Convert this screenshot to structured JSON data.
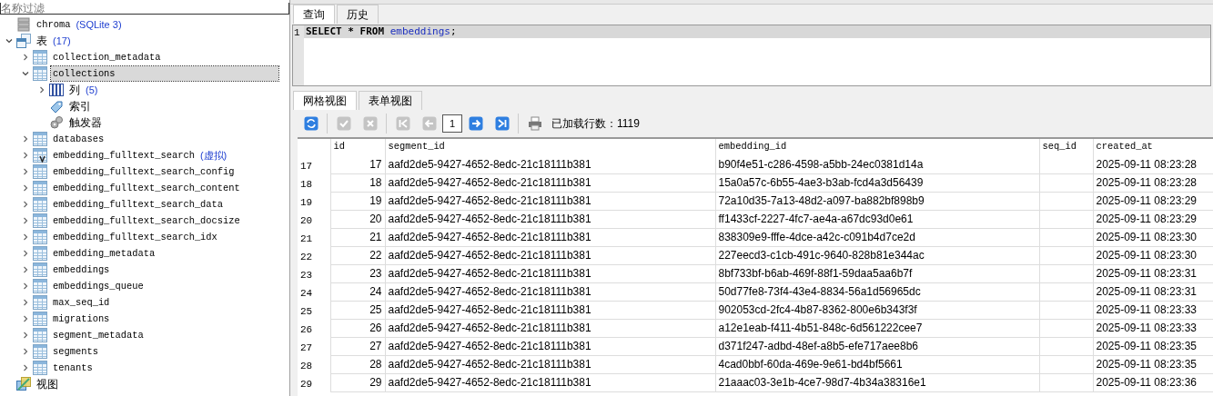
{
  "filter": {
    "placeholder": "名称过滤"
  },
  "tree": [
    {
      "label": "chroma",
      "note": "(SQLite 3)",
      "kind": "database",
      "selected": false,
      "children": [
        {
          "label": "表",
          "note": "(17)",
          "kind": "tables",
          "expanded": true,
          "selected": false,
          "children": [
            {
              "label": "collection_metadata",
              "kind": "table",
              "expanded": false,
              "selected": false
            },
            {
              "label": "collections",
              "kind": "table",
              "expanded": true,
              "selected": true,
              "children": [
                {
                  "label": "列",
                  "note": "(5)",
                  "kind": "columns",
                  "expanded": false,
                  "selected": false
                },
                {
                  "label": "索引",
                  "kind": "index",
                  "selected": false
                },
                {
                  "label": "触发器",
                  "kind": "trigger",
                  "selected": false
                }
              ]
            },
            {
              "label": "databases",
              "kind": "table",
              "expanded": false,
              "selected": false
            },
            {
              "label": "embedding_fulltext_search",
              "note": "(虚拟)",
              "kind": "virtual-table",
              "expanded": false,
              "selected": false
            },
            {
              "label": "embedding_fulltext_search_config",
              "kind": "table",
              "expanded": false,
              "selected": false
            },
            {
              "label": "embedding_fulltext_search_content",
              "kind": "table",
              "expanded": false,
              "selected": false
            },
            {
              "label": "embedding_fulltext_search_data",
              "kind": "table",
              "expanded": false,
              "selected": false
            },
            {
              "label": "embedding_fulltext_search_docsize",
              "kind": "table",
              "expanded": false,
              "selected": false
            },
            {
              "label": "embedding_fulltext_search_idx",
              "kind": "table",
              "expanded": false,
              "selected": false
            },
            {
              "label": "embedding_metadata",
              "kind": "table",
              "expanded": false,
              "selected": false
            },
            {
              "label": "embeddings",
              "kind": "table",
              "expanded": false,
              "selected": false
            },
            {
              "label": "embeddings_queue",
              "kind": "table",
              "expanded": false,
              "selected": false
            },
            {
              "label": "max_seq_id",
              "kind": "table",
              "expanded": false,
              "selected": false
            },
            {
              "label": "migrations",
              "kind": "table",
              "expanded": false,
              "selected": false
            },
            {
              "label": "segment_metadata",
              "kind": "table",
              "expanded": false,
              "selected": false
            },
            {
              "label": "segments",
              "kind": "table",
              "expanded": false,
              "selected": false
            },
            {
              "label": "tenants",
              "kind": "table",
              "expanded": false,
              "selected": false
            }
          ]
        },
        {
          "label": "视图",
          "kind": "views",
          "selected": false
        }
      ]
    }
  ],
  "editor_tabs": [
    {
      "label": "查询",
      "selected": true
    },
    {
      "label": "历史",
      "selected": false
    }
  ],
  "editor": {
    "line_number": "1",
    "tokens": [
      {
        "text": "SELECT * FROM",
        "kind": "keyword"
      },
      {
        "text": "embeddings",
        "kind": "identifier"
      },
      {
        "text": ";",
        "kind": "punct"
      }
    ]
  },
  "result_tabs": [
    {
      "label": "网格视图",
      "selected": true
    },
    {
      "label": "表单视图",
      "selected": false
    }
  ],
  "toolbar": {
    "buttons": [
      {
        "kind": "refresh",
        "disabled": false
      },
      {
        "kind": "apply",
        "disabled": true
      },
      {
        "kind": "cancel",
        "disabled": true
      },
      {
        "kind": "first",
        "disabled": true
      },
      {
        "kind": "prev",
        "disabled": true
      },
      {
        "kind": "page",
        "value": "1"
      },
      {
        "kind": "next",
        "disabled": false
      },
      {
        "kind": "last",
        "disabled": false
      },
      {
        "kind": "print",
        "disabled": false
      }
    ],
    "status": "已加载行数：1119"
  },
  "table": {
    "columns": [
      "id",
      "segment_id",
      "embedding_id",
      "seq_id",
      "created_at"
    ],
    "rows": [
      {
        "row_number": "17",
        "cells": [
          "17",
          "aafd2de5-9427-4652-8edc-21c18111b381",
          "b90f4e51-c286-4598-a5bb-24ec0381d14a",
          "",
          "2025-09-11 08:23:28"
        ]
      },
      {
        "row_number": "18",
        "cells": [
          "18",
          "aafd2de5-9427-4652-8edc-21c18111b381",
          "15a0a57c-6b55-4ae3-b3ab-fcd4a3d56439",
          "",
          "2025-09-11 08:23:28"
        ]
      },
      {
        "row_number": "19",
        "cells": [
          "19",
          "aafd2de5-9427-4652-8edc-21c18111b381",
          "72a10d35-7a13-48d2-a097-ba882bf898b9",
          "",
          "2025-09-11 08:23:29"
        ]
      },
      {
        "row_number": "20",
        "cells": [
          "20",
          "aafd2de5-9427-4652-8edc-21c18111b381",
          "ff1433cf-2227-4fc7-ae4a-a67dc93d0e61",
          "",
          "2025-09-11 08:23:29"
        ]
      },
      {
        "row_number": "21",
        "cells": [
          "21",
          "aafd2de5-9427-4652-8edc-21c18111b381",
          "838309e9-fffe-4dce-a42c-c091b4d7ce2d",
          "",
          "2025-09-11 08:23:30"
        ]
      },
      {
        "row_number": "22",
        "cells": [
          "22",
          "aafd2de5-9427-4652-8edc-21c18111b381",
          "227eecd3-c1cb-491c-9640-828b81e344ac",
          "",
          "2025-09-11 08:23:30"
        ]
      },
      {
        "row_number": "23",
        "cells": [
          "23",
          "aafd2de5-9427-4652-8edc-21c18111b381",
          "8bf733bf-b6ab-469f-88f1-59daa5aa6b7f",
          "",
          "2025-09-11 08:23:31"
        ]
      },
      {
        "row_number": "24",
        "cells": [
          "24",
          "aafd2de5-9427-4652-8edc-21c18111b381",
          "50d77fe8-73f4-43e4-8834-56a1d56965dc",
          "",
          "2025-09-11 08:23:31"
        ]
      },
      {
        "row_number": "25",
        "cells": [
          "25",
          "aafd2de5-9427-4652-8edc-21c18111b381",
          "902053cd-2fc4-4b87-8362-800e6b343f3f",
          "",
          "2025-09-11 08:23:33"
        ]
      },
      {
        "row_number": "26",
        "cells": [
          "26",
          "aafd2de5-9427-4652-8edc-21c18111b381",
          "a12e1eab-f411-4b51-848c-6d561222cee7",
          "",
          "2025-09-11 08:23:33"
        ]
      },
      {
        "row_number": "27",
        "cells": [
          "27",
          "aafd2de5-9427-4652-8edc-21c18111b381",
          "d371f247-adbd-48ef-a8b5-efe717aee8b6",
          "",
          "2025-09-11 08:23:35"
        ]
      },
      {
        "row_number": "28",
        "cells": [
          "28",
          "aafd2de5-9427-4652-8edc-21c18111b381",
          "4cad0bbf-60da-469e-9e61-bd4bf5661",
          "",
          "2025-09-11 08:23:35"
        ]
      },
      {
        "row_number": "29",
        "cells": [
          "29",
          "aafd2de5-9427-4652-8edc-21c18111b381",
          "21aaac03-3e1b-4ce7-98d7-4b34a38316e1",
          "",
          "2025-09-11 08:23:36"
        ]
      }
    ]
  }
}
